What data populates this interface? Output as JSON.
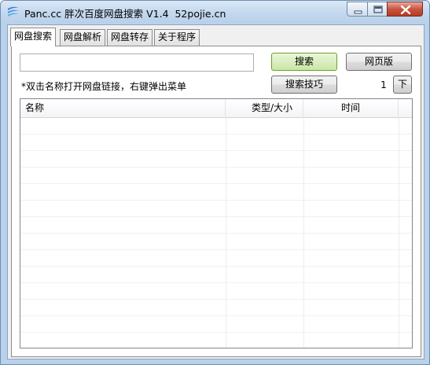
{
  "window": {
    "title": "Panc.cc 胖次百度网盘搜索 V1.4  52pojie.cn"
  },
  "tabs": [
    {
      "label": "网盘搜索",
      "active": true
    },
    {
      "label": "网盘解析",
      "active": false
    },
    {
      "label": "网盘转存",
      "active": false
    },
    {
      "label": "关于程序",
      "active": false
    }
  ],
  "search": {
    "value": "",
    "placeholder": "",
    "search_button": "搜索",
    "web_button": "网页版",
    "tips_button": "搜索技巧",
    "hint": "*双击名称打开网盘链接，右键弹出菜单",
    "page": "1",
    "next_button": "下"
  },
  "table": {
    "columns": [
      "名称",
      "类型/大小",
      "时间"
    ],
    "rows": []
  },
  "colors": {
    "title_bg": "#c5d9ef",
    "primary_button": "#c9e7a4",
    "client_bg": "#f0f0f0"
  }
}
